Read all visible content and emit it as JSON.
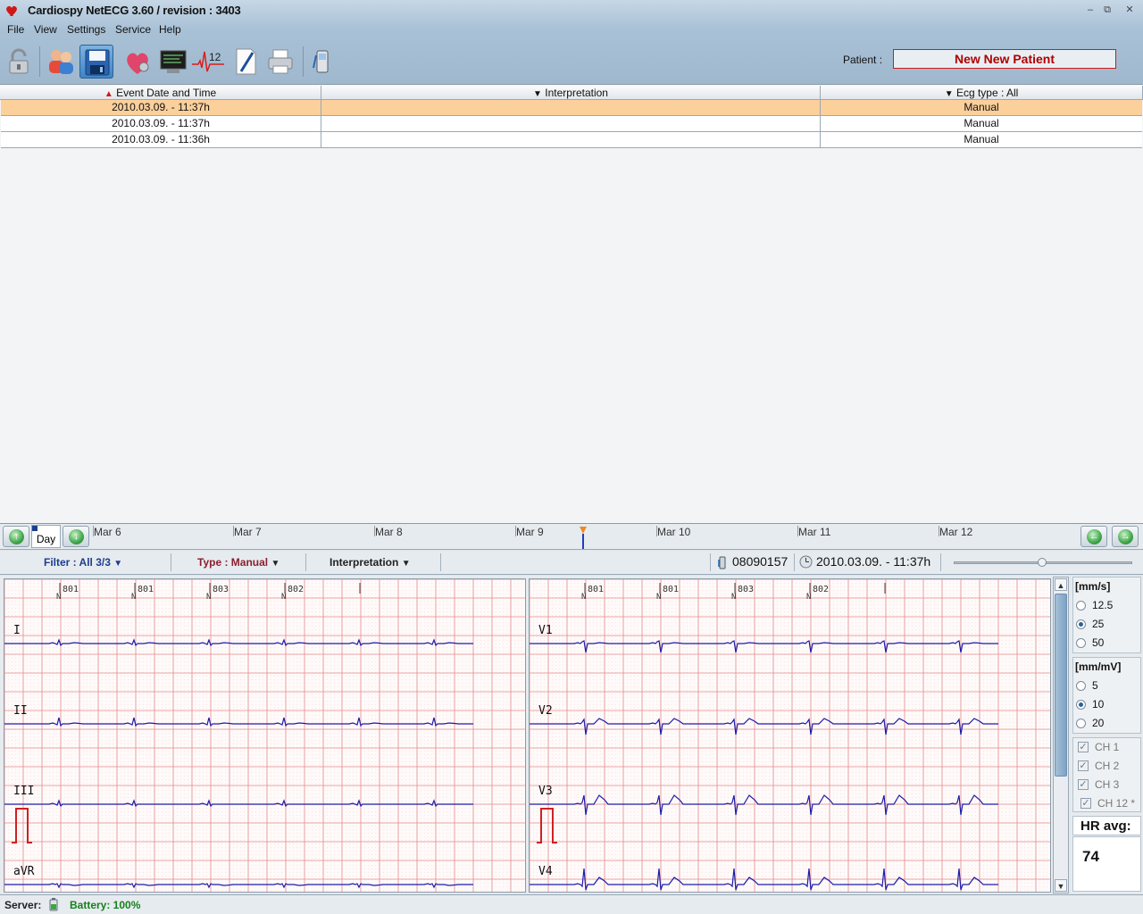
{
  "window": {
    "title": "Cardiospy NetECG 3.60 / revision : 3403",
    "minimize": "–",
    "restore": "⧉",
    "close": "✕"
  },
  "menu": [
    "File",
    "View",
    "Settings",
    "Service",
    "Help"
  ],
  "toolbar": {
    "buttons": [
      "unlock-icon",
      "patients-icon",
      "save-icon",
      "heart-icon",
      "monitor-icon",
      "ecg-12-lead-icon",
      "edit-document-icon",
      "printer-icon",
      "mobile-device-icon"
    ],
    "ecg12_text": "12",
    "active_button": "save-icon"
  },
  "patient": {
    "label": "Patient :",
    "name": "New New Patient"
  },
  "events_table": {
    "columns": [
      {
        "label": "Event Date and Time",
        "sort": "asc"
      },
      {
        "label": "Interpretation",
        "sort": "desc"
      },
      {
        "label": "Ecg type : All",
        "sort": "desc"
      }
    ],
    "rows": [
      {
        "datetime": "2010.03.09. - 11:37h",
        "interpretation": "",
        "ecg_type": "Manual",
        "selected": true
      },
      {
        "datetime": "2010.03.09. - 11:37h",
        "interpretation": "",
        "ecg_type": "Manual",
        "selected": false
      },
      {
        "datetime": "2010.03.09. - 11:36h",
        "interpretation": "",
        "ecg_type": "Manual",
        "selected": false
      }
    ]
  },
  "timeline": {
    "zoom_label": "Day",
    "dates": [
      "Mar 6",
      "Mar 7",
      "Mar 8",
      "Mar 9",
      "Mar 10",
      "Mar 11",
      "Mar 12"
    ]
  },
  "filters": {
    "filter_label": "Filter : All 3/3",
    "type_prefix": "Type : ",
    "type_value": "Manual",
    "interpretation_label": "Interpretation",
    "device_id": "08090157",
    "recorded_at": "2010.03.09. - 11:37h"
  },
  "ecg": {
    "beat_annotations": [
      "801",
      "801",
      "803",
      "802"
    ],
    "beat_symbol": "N",
    "left_leads": [
      "I",
      "II",
      "III",
      "aVR"
    ],
    "right_leads": [
      "V1",
      "V2",
      "V3",
      "V4"
    ],
    "grid_color": "#e58a8a",
    "trace_color": "#1c1ca8",
    "calibration_color": "#d02020"
  },
  "settings": {
    "speed_title": "[mm/s]",
    "speed_options": [
      "12.5",
      "25",
      "50"
    ],
    "speed_selected": "25",
    "gain_title": "[mm/mV]",
    "gain_options": [
      "5",
      "10",
      "20"
    ],
    "gain_selected": "10",
    "channels": [
      "CH 1",
      "CH 2",
      "CH 3",
      "CH 12 *"
    ],
    "hr_label": "HR avg:",
    "hr_value": "74"
  },
  "status": {
    "server_label": "Server:",
    "battery": "Battery: 100%"
  }
}
